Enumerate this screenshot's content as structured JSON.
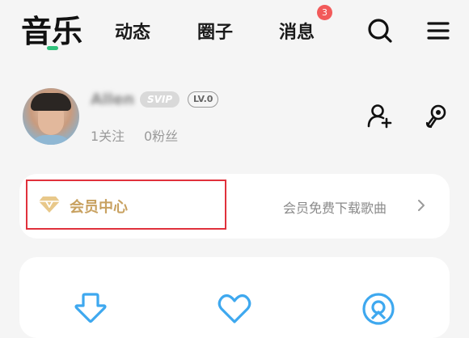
{
  "nav": {
    "tabs": [
      {
        "label": "音乐",
        "active": true
      },
      {
        "label": "动态",
        "active": false
      },
      {
        "label": "圈子",
        "active": false
      },
      {
        "label": "消息",
        "active": false,
        "badge": "3"
      }
    ],
    "icons": [
      "search-icon",
      "menu-icon"
    ]
  },
  "profile": {
    "username": "Allen",
    "svip_badge": "SVIP",
    "level_badge": "LV.0",
    "following": "1关注",
    "fans": "0粉丝",
    "actions": [
      "add-user-icon",
      "singer-mic-icon"
    ]
  },
  "vip": {
    "title": "会员中心",
    "desc": "会员免费下载歌曲",
    "icon": "diamond-icon",
    "accent_color": "#c8a160",
    "highlight_color": "#e0313c"
  },
  "quick_actions": {
    "icons": [
      "download-icon",
      "heart-icon",
      "radio-icon"
    ],
    "icon_color": "#3ea8ef"
  }
}
